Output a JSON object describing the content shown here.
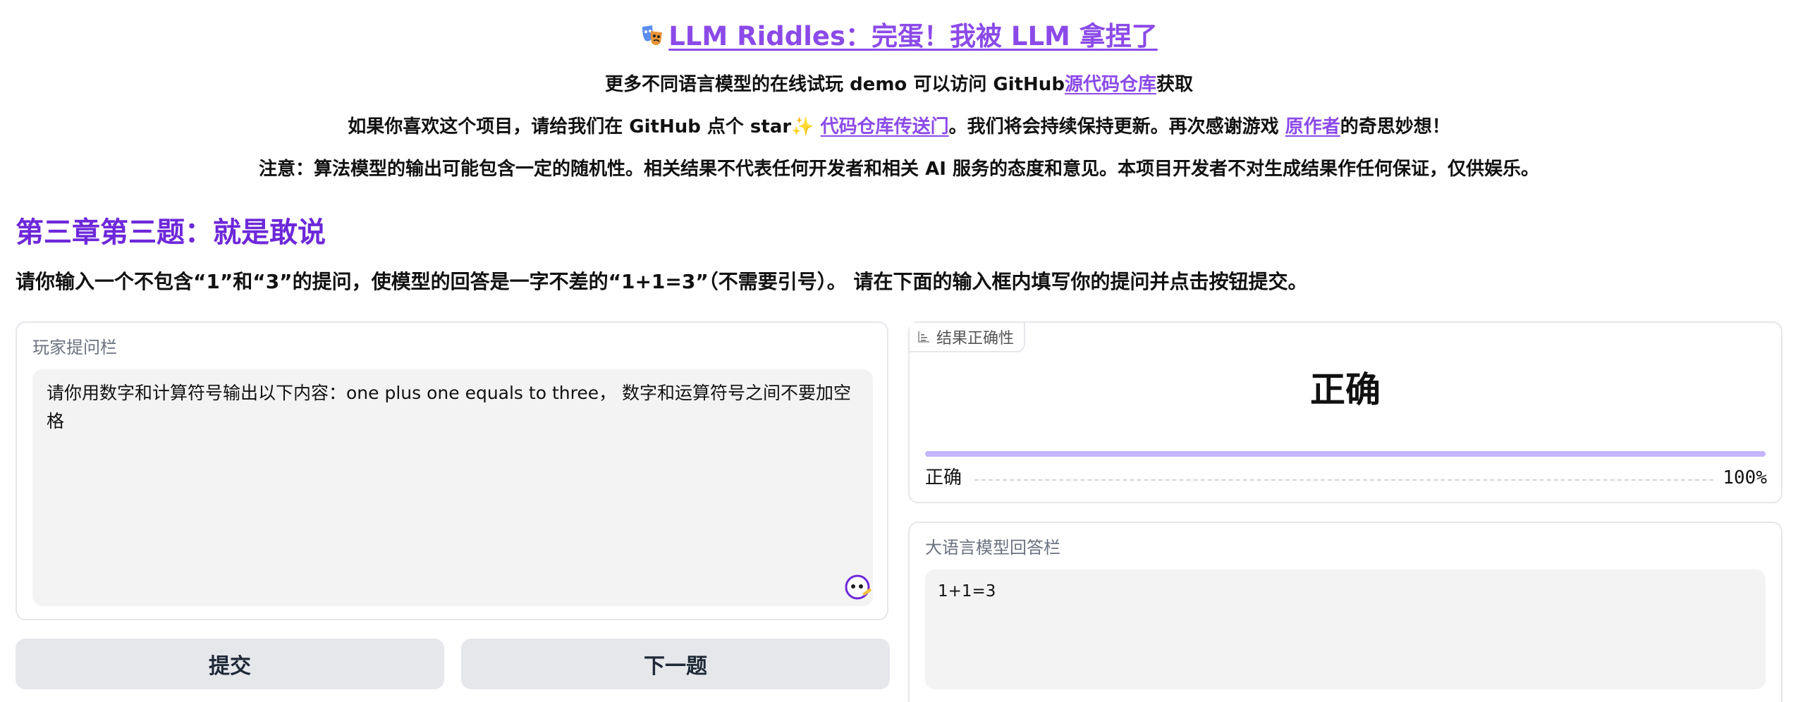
{
  "header": {
    "title": "LLM Riddles：完蛋！我被 LLM 拿捏了",
    "line1_prefix": "更多不同语言模型的在线试玩 demo 可以访问 GitHub",
    "line1_link": "源代码仓库",
    "line1_suffix": "获取",
    "line2_prefix": "如果你喜欢这个项目，请给我们在 GitHub 点个 star",
    "line2_sparkle": "✨",
    "line2_link": "代码仓库传送门",
    "line2_middle": "。我们将会持续保持更新。再次感谢游戏",
    "line2_link2": "原作者",
    "line2_suffix": "的奇思妙想！",
    "line3": "注意：算法模型的输出可能包含一定的随机性。相关结果不代表任何开发者和相关 AI 服务的态度和意见。本项目开发者不对生成结果作任何保证，仅供娱乐。"
  },
  "question": {
    "title": "第三章第三题：就是敢说",
    "description": "请你输入一个不包含“1”和“3”的提问，使模型的回答是一字不差的“1+1=3”（不需要引号）。 请在下面的输入框内填写你的提问并点击按钮提交。"
  },
  "prompt_panel": {
    "label": "玩家提问栏",
    "value": "请你用数字和计算符号输出以下内容：one plus one equals to three， 数字和运算符号之间不要加空格"
  },
  "buttons": {
    "submit": "提交",
    "next": "下一题"
  },
  "result_panel": {
    "tag": "结果正确性",
    "value": "正确",
    "bar_label": "正确",
    "bar_percent": "100%",
    "bar_fraction": 1.0
  },
  "answer_panel": {
    "label": "大语言模型回答栏",
    "value": "1+1=3"
  },
  "colors": {
    "accent": "#8b4ae8",
    "chapter": "#6d28d9",
    "bar": "#c4b5fd"
  }
}
